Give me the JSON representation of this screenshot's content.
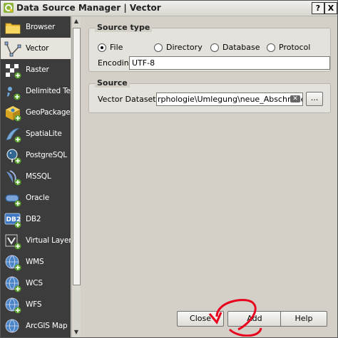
{
  "window": {
    "title": "Data Source Manager | Vector",
    "help_btn": "?",
    "close_btn": "X"
  },
  "sidebar": {
    "items": [
      {
        "label": "Browser",
        "icon": "folder-icon"
      },
      {
        "label": "Vector",
        "icon": "vector-icon",
        "selected": true
      },
      {
        "label": "Raster",
        "icon": "raster-icon"
      },
      {
        "label": "Delimited Text",
        "icon": "delimited-text-icon"
      },
      {
        "label": "GeoPackage",
        "icon": "geopackage-icon"
      },
      {
        "label": "SpatiaLite",
        "icon": "spatialite-icon"
      },
      {
        "label": "PostgreSQL",
        "icon": "postgresql-icon"
      },
      {
        "label": "MSSQL",
        "icon": "mssql-icon"
      },
      {
        "label": "Oracle",
        "icon": "oracle-icon"
      },
      {
        "label": "DB2",
        "icon": "db2-icon"
      },
      {
        "label": "Virtual Layer",
        "icon": "virtual-layer-icon"
      },
      {
        "label": "WMS",
        "icon": "wms-icon"
      },
      {
        "label": "WCS",
        "icon": "wcs-icon"
      },
      {
        "label": "WFS",
        "icon": "wfs-icon"
      },
      {
        "label": "ArcGIS Map",
        "icon": "arcgis-map-icon"
      }
    ]
  },
  "source_type": {
    "title": "Source type",
    "options": [
      "File",
      "Directory",
      "Database",
      "Protocol"
    ],
    "selected": "File",
    "encoding_label": "Encoding",
    "encoding_value": "UTF-8"
  },
  "source": {
    "title": "Source",
    "dataset_label": "Vector Dataset(s)",
    "dataset_value": "rphologie\\Umlegung\\neue_Abschnitte.shp",
    "browse_label": "..."
  },
  "buttons": {
    "close": "Close",
    "add": "Add",
    "help": "Help"
  },
  "colors": {
    "sidebar_bg": "#3c3c3c",
    "dialog_bg": "#d4d0c8",
    "annotation": "#e8001c"
  }
}
